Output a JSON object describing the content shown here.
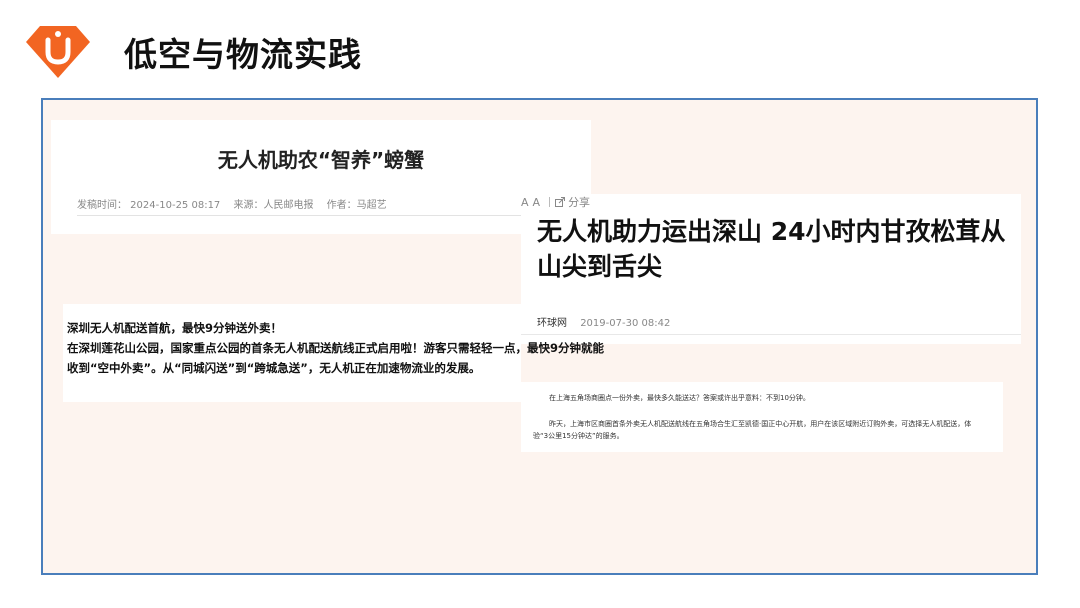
{
  "slide": {
    "title": "低空与物流实践",
    "brand_color": "#f26522",
    "panel_border": "#4a7ebb",
    "panel_bg": "#fdf4ef"
  },
  "clip1": {
    "headline": "无人机助农“智养”螃蟹",
    "meta_time": "发稿时间：  2024-10-25 08:17",
    "meta_source": "来源：人民邮电报",
    "meta_author": "作者：马超艺"
  },
  "clip2": {
    "tools": [
      "A",
      "A"
    ],
    "share_label": "分享",
    "headline": "无人机助力运出深山 24小时内甘孜松茸从山尖到舌尖",
    "source": "环球网",
    "datetime": "2019-07-30 08:42"
  },
  "clip3": {
    "lines": [
      "深圳无人机配送首航，最快9分钟送外卖！",
      "在深圳莲花山公园，国家重点公园的首条无人机配送航线正式启用啦！游客只需轻轻一点，最快9分钟就能",
      "收到“空中外卖”。从“同城闪送”到“跨城急送”，无人机正在加速物流业的发展。"
    ]
  },
  "clip4": {
    "para1": "在上海五角场商圈点一份外卖，最快多久能送达？答案或许出乎意料：不到10分钟。",
    "para2_lines": [
      "昨天，上海市区商圈首条外卖无人机配送航线在五角场合生汇至凯德·国正中心开航，用户在该区域附近订购外卖，可选择无人机配送，体",
      "验“3公里15分钟达”的服务。"
    ]
  }
}
